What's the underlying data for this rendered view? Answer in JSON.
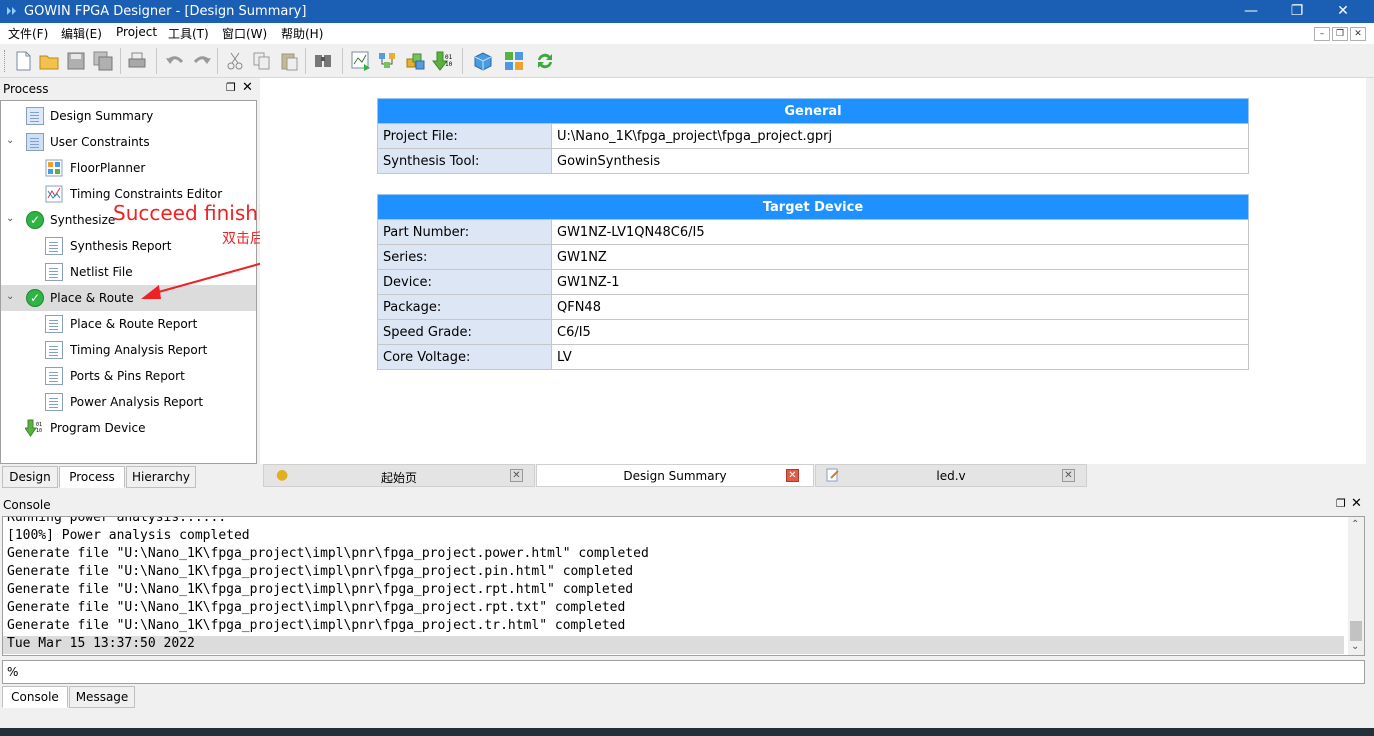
{
  "window": {
    "title": "GOWIN FPGA Designer - [Design Summary]"
  },
  "menu": [
    "文件(F)",
    "编辑(E)",
    "Project",
    "工具(T)",
    "窗口(W)",
    "帮助(H)"
  ],
  "toolbar": {
    "icons": [
      "new-file-icon",
      "open-folder-icon",
      "save-icon",
      "save-all-icon",
      "print-icon",
      "undo-icon",
      "redo-icon",
      "cut-icon",
      "copy-icon",
      "paste-icon",
      "find-icon",
      "synthesize-run-icon",
      "place-route-run-icon",
      "program-run-icon",
      "program-device-icon",
      "ip-core-icon",
      "floorplanner-icon",
      "refresh-icon"
    ]
  },
  "process_panel": {
    "title": "Process",
    "items": [
      {
        "label": "Design Summary",
        "icon": "summary-icon"
      },
      {
        "label": "User Constraints",
        "icon": "constraints-icon"
      },
      {
        "label": "FloorPlanner",
        "icon": "floorplanner-icon"
      },
      {
        "label": "Timing Constraints Editor",
        "icon": "timing-icon"
      },
      {
        "label": "Synthesize",
        "icon": "success-check-icon"
      },
      {
        "label": "Synthesis Report",
        "icon": "document-icon"
      },
      {
        "label": "Netlist File",
        "icon": "document-icon"
      },
      {
        "label": "Place & Route",
        "icon": "success-check-icon"
      },
      {
        "label": "Place & Route Report",
        "icon": "document-icon"
      },
      {
        "label": "Timing Analysis Report",
        "icon": "document-icon"
      },
      {
        "label": "Ports & Pins Report",
        "icon": "document-icon"
      },
      {
        "label": "Power Analysis Report",
        "icon": "document-icon"
      },
      {
        "label": "Program Device",
        "icon": "download-icon"
      }
    ],
    "tabs": [
      "Design",
      "Process",
      "Hierarchy"
    ]
  },
  "annotations": {
    "english": "Succeed finishing running",
    "chinese": "双击后运行成功的样子"
  },
  "summary": {
    "general": {
      "header": "General",
      "rows": [
        {
          "key": "Project File:",
          "value": "U:\\Nano_1K\\fpga_project\\fpga_project.gprj"
        },
        {
          "key": "Synthesis Tool:",
          "value": "GowinSynthesis"
        }
      ]
    },
    "target": {
      "header": "Target Device",
      "rows": [
        {
          "key": "Part Number:",
          "value": "GW1NZ-LV1QN48C6/I5"
        },
        {
          "key": "Series:",
          "value": "GW1NZ"
        },
        {
          "key": "Device:",
          "value": "GW1NZ-1"
        },
        {
          "key": "Package:",
          "value": "QFN48"
        },
        {
          "key": "Speed Grade:",
          "value": "C6/I5"
        },
        {
          "key": "Core Voltage:",
          "value": "LV"
        }
      ]
    }
  },
  "doc_tabs": [
    {
      "label": "起始页"
    },
    {
      "label": "Design Summary"
    },
    {
      "label": "led.v"
    }
  ],
  "console": {
    "title": "Console",
    "lines": [
      "Running power analysis......",
      "[100%] Power analysis completed",
      "Generate file \"U:\\Nano_1K\\fpga_project\\impl\\pnr\\fpga_project.power.html\" completed",
      "Generate file \"U:\\Nano_1K\\fpga_project\\impl\\pnr\\fpga_project.pin.html\" completed",
      "Generate file \"U:\\Nano_1K\\fpga_project\\impl\\pnr\\fpga_project.rpt.html\" completed",
      "Generate file \"U:\\Nano_1K\\fpga_project\\impl\\pnr\\fpga_project.rpt.txt\" completed",
      "Generate file \"U:\\Nano_1K\\fpga_project\\impl\\pnr\\fpga_project.tr.html\" completed",
      "Tue Mar 15 13:37:50 2022"
    ],
    "input_value": "%",
    "tabs": [
      "Console",
      "Message"
    ]
  },
  "colors": {
    "title_bar": "#1a5fb4",
    "table_header": "#1e90ff",
    "success": "#2fb344",
    "annotation": "#ee2222"
  }
}
